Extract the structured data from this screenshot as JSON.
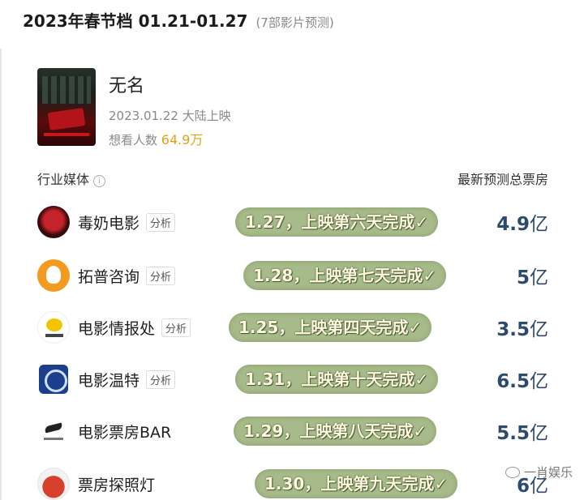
{
  "header": {
    "title": "2023年春节档 01.21-01.27",
    "subtitle": "(7部影片预测)"
  },
  "movie": {
    "name": "无名",
    "release": "2023.01.22 大陆上映",
    "want_label": "想看人数",
    "want_value": "64.9万"
  },
  "columns": {
    "left": "行业媒体",
    "right": "最新预测总票房",
    "info_icon": "i"
  },
  "rows": [
    {
      "name": "毒奶电影",
      "tag": "分析",
      "note": "1.27，上映第六天完成✓",
      "value": "4.9",
      "unit": "亿"
    },
    {
      "name": "拓普咨询",
      "tag": "分析",
      "note": "1.28，上映第七天完成✓",
      "value": "5",
      "unit": "亿"
    },
    {
      "name": "电影情报处",
      "tag": "分析",
      "note": "1.25，上映第四天完成✓",
      "value": "3.5",
      "unit": "亿"
    },
    {
      "name": "电影温特",
      "tag": "分析",
      "note": "1.31，上映第十天完成✓",
      "value": "6.5",
      "unit": "亿"
    },
    {
      "name": "电影票房BAR",
      "tag": "",
      "note": "1.29，上映第八天完成✓",
      "value": "5.5",
      "unit": "亿"
    },
    {
      "name": "票房探照灯",
      "tag": "",
      "note": "1.30，上映第九天完成✓",
      "value": "6",
      "unit": "亿"
    }
  ],
  "watermark": "一肖娱乐"
}
